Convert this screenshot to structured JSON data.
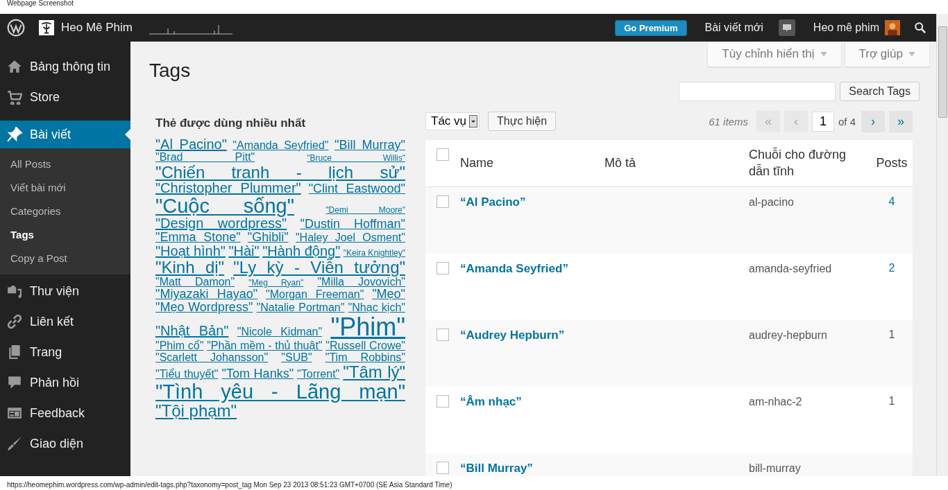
{
  "capture_title": "Webpage Screenshot",
  "admin_bar": {
    "site_name": "Heo Mê Phim",
    "premium_button": "Go Premium",
    "new_post": "Bài viết mới",
    "user_name": "Heo mê phim"
  },
  "sidebar": {
    "items": [
      {
        "label": "Bảng thông tin",
        "selected": false
      },
      {
        "label": "Store",
        "selected": false
      },
      {
        "label": "Bài viết",
        "selected": true,
        "children": [
          {
            "label": "All Posts",
            "selected": false
          },
          {
            "label": "Viết bài mới",
            "selected": false
          },
          {
            "label": "Categories",
            "selected": false
          },
          {
            "label": "Tags",
            "selected": true
          },
          {
            "label": "Copy a Post",
            "selected": false
          }
        ]
      },
      {
        "label": "Thư viện",
        "selected": false
      },
      {
        "label": "Liên kết",
        "selected": false
      },
      {
        "label": "Trang",
        "selected": false
      },
      {
        "label": "Phản hồi",
        "selected": false
      },
      {
        "label": "Feedback",
        "selected": false
      },
      {
        "label": "Giao diện",
        "selected": false
      }
    ]
  },
  "screen_tabs": [
    "Tùy chỉnh hiển thị",
    "Trợ giúp"
  ],
  "page_title": "Tags",
  "tag_cloud": {
    "title": "Thẻ được dùng nhiều nhất",
    "tags": [
      {
        "label": "\"Al Pacino\"",
        "kind": "large"
      },
      {
        "label": "\"Amanda Seyfried\"",
        "kind": "small"
      },
      {
        "label": "\"Bill Murray\"",
        "kind": "medium"
      },
      {
        "label": "\"Brad Pitt\"",
        "kind": "small"
      },
      {
        "label": "\"Bruce Willis\"",
        "kind": "tiny"
      },
      {
        "label": "\"Chiến tranh - lịch sử\"",
        "kind": "big"
      },
      {
        "label": "\"Christopher Plummer\"",
        "kind": "large"
      },
      {
        "label": "\"Clint Eastwood\"",
        "kind": "medium"
      },
      {
        "label": "\"Cuộc sống\"",
        "kind": "huge"
      },
      {
        "label": "\"Demi Moore\"",
        "kind": "tiny"
      },
      {
        "label": "\"Design wordpress\"",
        "kind": "large"
      },
      {
        "label": "\"Dustin Hoffman\"",
        "kind": "medium"
      },
      {
        "label": "\"Emma Stone\"",
        "kind": "medium"
      },
      {
        "label": "\"Ghibli\"",
        "kind": "medium"
      },
      {
        "label": "\"Haley Joel Osment\"",
        "kind": "small"
      },
      {
        "label": "\"Hoạt hình\"",
        "kind": "large"
      },
      {
        "label": "\"Hài\"",
        "kind": "large"
      },
      {
        "label": "\"Hành động\"",
        "kind": "large"
      },
      {
        "label": "\"Keira Knightley\"",
        "kind": "tiny"
      },
      {
        "label": "\"Kinh dị\"",
        "kind": "big"
      },
      {
        "label": "\"Ly kỳ - Viễn tưởng\"",
        "kind": "big"
      },
      {
        "label": "\"Matt Damon\"",
        "kind": "small"
      },
      {
        "label": "\"Meg Ryan\"",
        "kind": "tiny"
      },
      {
        "label": "\"Milla Jovovich\"",
        "kind": "small"
      },
      {
        "label": "\"Miyazaki Hayao\"",
        "kind": "medium"
      },
      {
        "label": "\"Morgan Freeman\"",
        "kind": "small"
      },
      {
        "label": "\"Mẹo\"",
        "kind": "medium"
      },
      {
        "label": "\"Mẹo Wordpress\"",
        "kind": "medium"
      },
      {
        "label": "\"Natalie Portman\"",
        "kind": "small"
      },
      {
        "label": "\"Nhạc kịch\"",
        "kind": "small"
      },
      {
        "label": "\"Nhật Bản\"",
        "kind": "large"
      },
      {
        "label": "\"Nicole Kidman\"",
        "kind": "small"
      },
      {
        "label": "\"Phim\"",
        "kind": "giant"
      },
      {
        "label": "\"Phim cổ\"",
        "kind": "small"
      },
      {
        "label": "\"Phần mềm - thủ thuật\"",
        "kind": "small"
      },
      {
        "label": "\"Russell Crowe\"",
        "kind": "small"
      },
      {
        "label": "\"Scarlett Johansson\"",
        "kind": "small"
      },
      {
        "label": "\"SUB\"",
        "kind": "small"
      },
      {
        "label": "\"Tim Robbins\"",
        "kind": "small"
      },
      {
        "label": "\"Tiểu thuyết\"",
        "kind": "small"
      },
      {
        "label": "\"Tom Hanks\"",
        "kind": "medium"
      },
      {
        "label": "\"Torrent\"",
        "kind": "small"
      },
      {
        "label": "\"Tâm lý\"",
        "kind": "big"
      },
      {
        "label": "\"Tình yêu - Lãng mạn\"",
        "kind": "huge"
      },
      {
        "label": "\"Tội phạm\"",
        "kind": "big"
      }
    ]
  },
  "search": {
    "button": "Search Tags"
  },
  "bulk": {
    "select": "Tác vụ",
    "apply": "Thực hiện"
  },
  "pagination": {
    "count": "61 items",
    "first": "«",
    "prev": "‹",
    "page": "1",
    "of": "of 4",
    "next": "›",
    "last": "»"
  },
  "table": {
    "select_all_checked": false,
    "columns": [
      "Name",
      "Mô tả",
      "Chuỗi cho đường dẫn tĩnh",
      "Posts"
    ],
    "rows": [
      {
        "name": "“Al Pacino”",
        "slug": "al-pacino",
        "posts": "4",
        "posts_linked": true,
        "checked": false
      },
      {
        "name": "“Amanda Seyfried”",
        "slug": "amanda-seyfried",
        "posts": "2",
        "posts_linked": true,
        "checked": false
      },
      {
        "name": "“Audrey Hepburn”",
        "slug": "audrey-hepburn",
        "posts": "1",
        "posts_linked": false,
        "checked": false
      },
      {
        "name": "“Âm nhạc”",
        "slug": "am-nhac-2",
        "posts": "1",
        "posts_linked": false,
        "checked": false
      },
      {
        "name": "“Bill Murray”",
        "slug": "bill-murray",
        "checked": false
      }
    ]
  },
  "status_text": "https://heomephim.wordpress.com/wp-admin/edit-tags.php?taxonomy=post_tag Mon Sep 23 2013 08:51:23 GMT+0700 (SE Asia Standard Time)"
}
